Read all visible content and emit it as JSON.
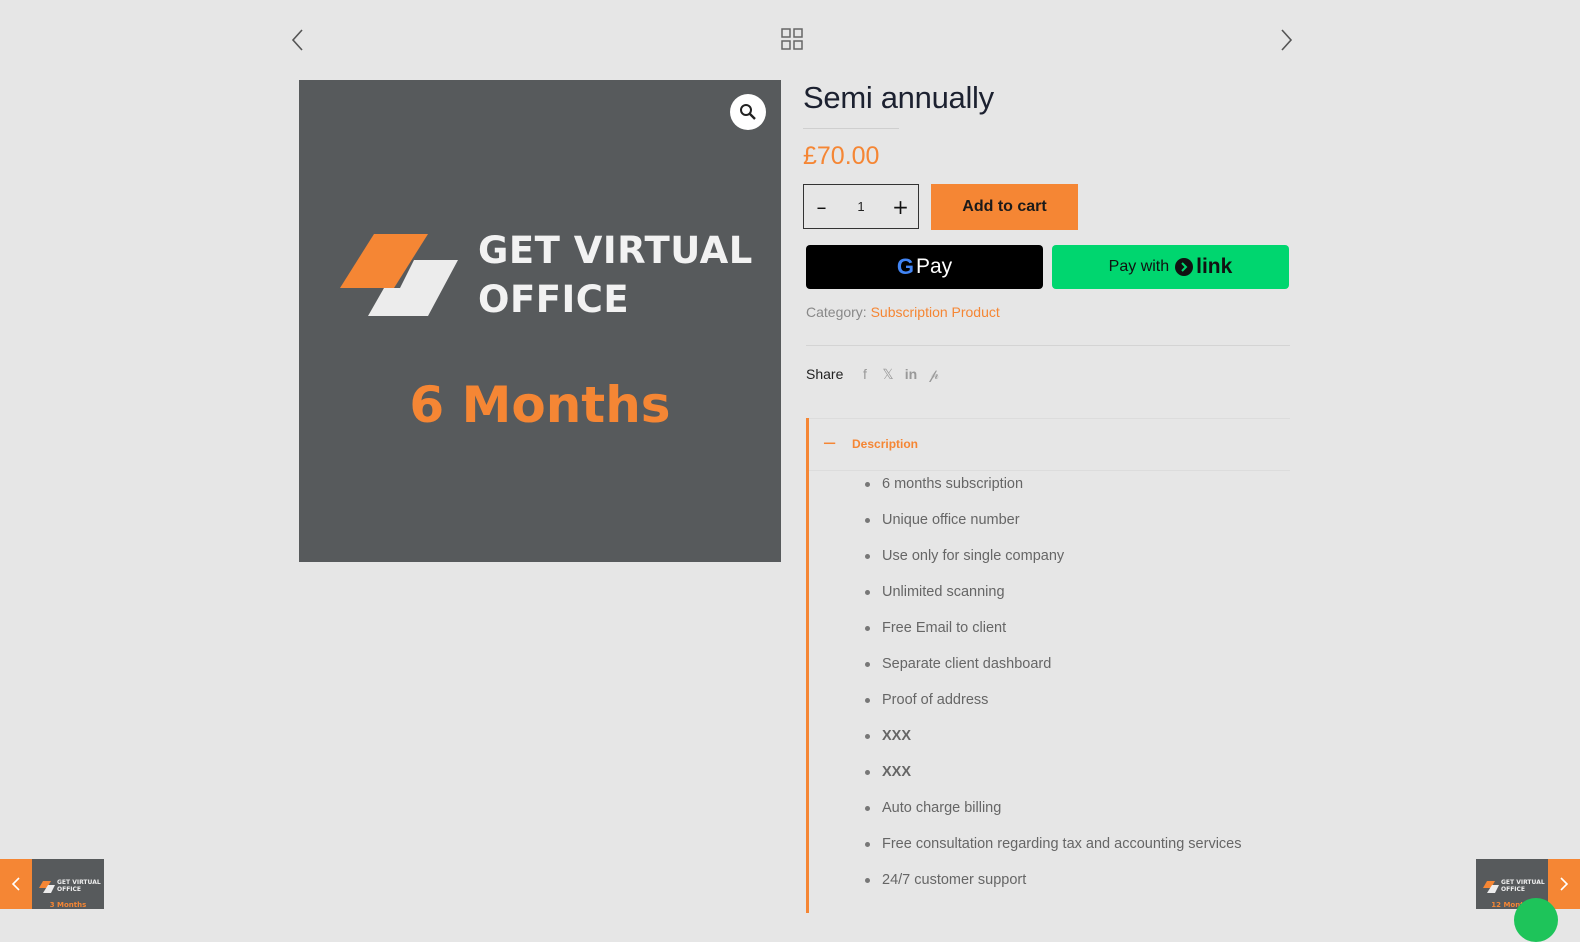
{
  "colors": {
    "accent": "#f58634",
    "image_bg": "#575a5c",
    "link_green": "#00d66f",
    "page_bg": "#e6e6e6"
  },
  "nav": {
    "prev_icon": "chevron-left-icon",
    "grid_icon": "grid-icon",
    "next_icon": "chevron-right-icon"
  },
  "image": {
    "brand_line1": "GET VIRTUAL",
    "brand_line2": "OFFICE",
    "caption": "6 Months",
    "zoom_icon": "magnifier-icon"
  },
  "product": {
    "title": "Semi annually",
    "price": "£70.00",
    "quantity": "1",
    "qty_minus": "–",
    "qty_plus": "+",
    "add_to_cart": "Add to cart",
    "gpay_g": "G",
    "gpay_label": "Pay",
    "link_prefix": "Pay with",
    "link_label": "link",
    "category_label": "Category:",
    "category_value": "Subscription Product"
  },
  "share": {
    "label": "Share",
    "facebook": "f",
    "x": "𝕏",
    "linkedin": "in",
    "pinterest": "𝓅"
  },
  "description": {
    "toggle": "−",
    "title": "Description",
    "items": [
      "6 months subscription",
      "Unique office number",
      "Use only for single company",
      "Unlimited scanning",
      "Free Email to client",
      "Separate client dashboard",
      "Proof of address",
      "XXX",
      "XXX",
      "Auto charge billing",
      "Free consultation regarding tax and accounting services",
      "24/7 customer support"
    ]
  },
  "thumbs": {
    "prev": {
      "line1": "GET VIRTUAL",
      "line2": "OFFICE",
      "caption": "3 Months"
    },
    "next": {
      "line1": "GET VIRTUAL",
      "line2": "OFFICE",
      "caption": "12 Months"
    }
  }
}
